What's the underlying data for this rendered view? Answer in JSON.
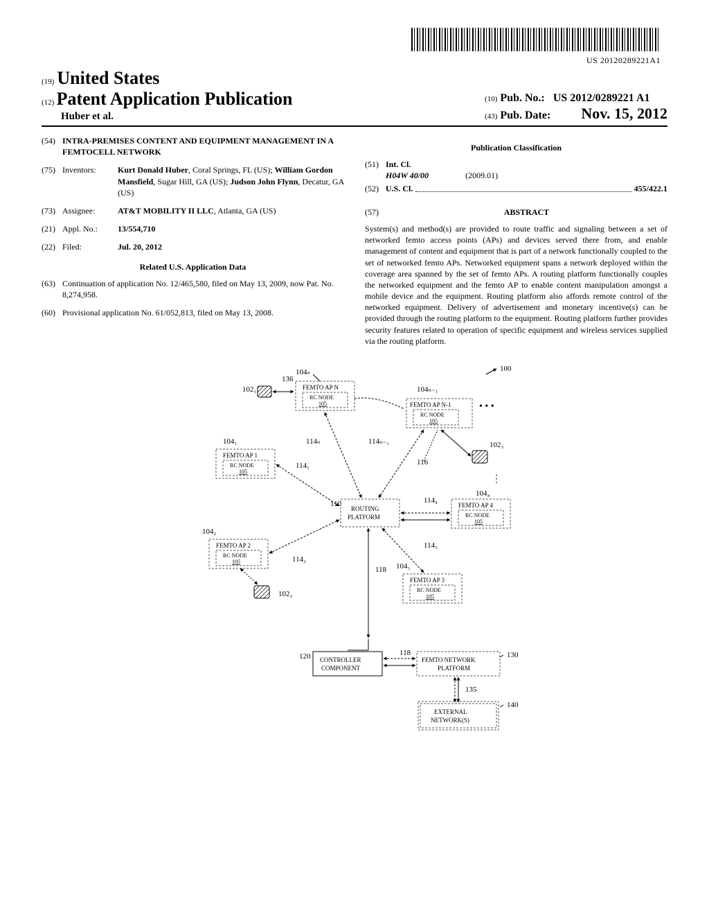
{
  "top": {
    "doc_code": "US 20120289221A1"
  },
  "header": {
    "country_prefix": "(19)",
    "country": "United States",
    "pub_prefix": "(12)",
    "pub_type": "Patent Application Publication",
    "authors": "Huber et al.",
    "pubno_prefix": "(10)",
    "pubno_label": "Pub. No.:",
    "pubno_value": "US 2012/0289221 A1",
    "pubdate_prefix": "(43)",
    "pubdate_label": "Pub. Date:",
    "pubdate_value": "Nov. 15, 2012"
  },
  "left": {
    "title_code": "(54)",
    "title": "INTRA-PREMISES CONTENT AND EQUIPMENT MANAGEMENT IN A FEMTOCELL NETWORK",
    "inventors_code": "(75)",
    "inventors_label": "Inventors:",
    "inventors_value": "Kurt Donald Huber, Coral Springs, FL (US); William Gordon Mansfield, Sugar Hill, GA (US); Judson John Flynn, Decatur, GA (US)",
    "assignee_code": "(73)",
    "assignee_label": "Assignee:",
    "assignee_value": "AT&T MOBILITY II LLC, Atlanta, GA (US)",
    "appl_code": "(21)",
    "appl_label": "Appl. No.:",
    "appl_value": "13/554,710",
    "filed_code": "(22)",
    "filed_label": "Filed:",
    "filed_value": "Jul. 20, 2012",
    "related_header": "Related U.S. Application Data",
    "cont_code": "(63)",
    "cont_value": "Continuation of application No. 12/465,580, filed on May 13, 2009, now Pat. No. 8,274,958.",
    "prov_code": "(60)",
    "prov_value": "Provisional application No. 61/052,813, filed on May 13, 2008."
  },
  "right": {
    "class_header": "Publication Classification",
    "intcl_code": "(51)",
    "intcl_label": "Int. Cl.",
    "intcl_class": "H04W 40/00",
    "intcl_date": "(2009.01)",
    "uscl_code": "(52)",
    "uscl_label": "U.S. Cl.",
    "uscl_value": "455/422.1",
    "abstract_code": "(57)",
    "abstract_label": "ABSTRACT",
    "abstract_text": "System(s) and method(s) are provided to route traffic and signaling between a set of networked femto access points (APs) and devices served there from, and enable management of content and equipment that is part of a network functionally coupled to the set of networked femto APs. Networked equipment spans a network deployed within the coverage area spanned by the set of femto APs. A routing platform functionally couples the networked equipment and the femto AP to enable content manipulation amongst a mobile device and the equipment. Routing platform also affords remote control of the networked equipment. Delivery of advertisement and monetary incentive(s) can be provided through the routing platform to the equipment. Routing platform further provides security features related to operation of specific equipment and wireless services supplied via the routing platform."
  },
  "figure": {
    "ref_100": "100",
    "ref_136": "136",
    "ref_102_1": "102₁",
    "ref_102_2": "102₂",
    "ref_102_3": "102₃",
    "ref_104_1": "104₁",
    "ref_104_2": "104₂",
    "ref_104_3": "104₃",
    "ref_104_4": "104₄",
    "ref_104_N": "104ₙ",
    "ref_104_N1": "104ₙ₋₁",
    "ref_105": "105",
    "ref_110": "110",
    "ref_114_1": "114₁",
    "ref_114_2": "114₂",
    "ref_114_3": "114₃",
    "ref_114_4": "114₄",
    "ref_114_N": "114ₙ",
    "ref_114_N1": "114ₙ₋₁",
    "ref_116": "116",
    "ref_118": "118",
    "ref_120": "120",
    "ref_130": "130",
    "ref_135": "135",
    "ref_140": "140",
    "label_femto_ap_n": "FEMTO AP N",
    "label_femto_ap_n1": "FEMTO AP N-1",
    "label_femto_ap_1": "FEMTO AP 1",
    "label_femto_ap_2": "FEMTO AP 2",
    "label_femto_ap_3": "FEMTO AP 3",
    "label_femto_ap_4": "FEMTO AP 4",
    "label_rc_node": "RC NODE",
    "label_routing": "ROUTING",
    "label_platform": "PLATFORM",
    "label_controller": "CONTROLLER",
    "label_component": "COMPONENT",
    "label_femto_network": "FEMTO NETWORK",
    "label_network_platform": "PLATFORM",
    "label_external": "EXTERNAL",
    "label_networks": "NETWORK(S)",
    "dots": "• • •"
  }
}
